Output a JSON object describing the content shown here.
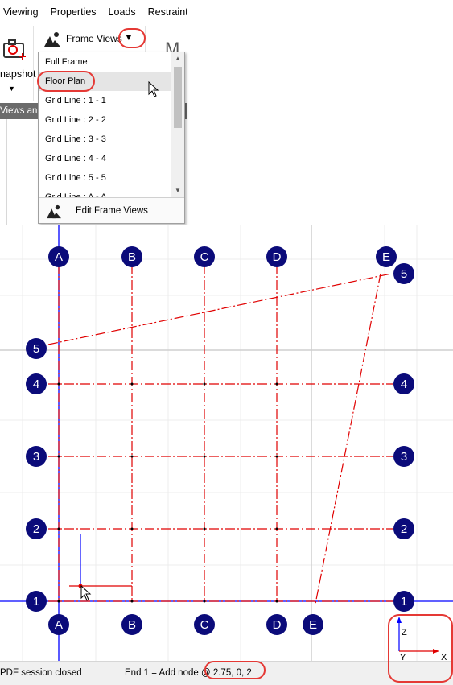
{
  "menu": [
    "Viewing",
    "Properties",
    "Loads",
    "Restraint"
  ],
  "ribbon": {
    "snapshot_label": "napshot",
    "snapshot_caret": "▼",
    "frame_views_label": "Frame Views",
    "frame_views_caret": "▼",
    "m_label": "M",
    "views_strip": "Views and"
  },
  "dropdown": {
    "items": [
      "Full Frame",
      "Floor Plan",
      "Grid Line : 1 - 1",
      "Grid Line : 2 - 2",
      "Grid Line : 3 - 3",
      "Grid Line : 4 - 4",
      "Grid Line : 5 - 5",
      "Grid Line : A - A"
    ],
    "hovered": "Floor Plan",
    "edit_label": "Edit Frame Views"
  },
  "grid": {
    "columns": [
      {
        "top": "A",
        "bottom": "A"
      },
      {
        "top": "B",
        "bottom": "B"
      },
      {
        "top": "C",
        "bottom": "C"
      },
      {
        "top": "D",
        "bottom": "D"
      },
      {
        "top": "E",
        "bottom": "E"
      }
    ],
    "rows": [
      {
        "left": "5",
        "right": "5"
      },
      {
        "left": "4",
        "right": "4"
      },
      {
        "left": "3",
        "right": "3"
      },
      {
        "left": "2",
        "right": "2"
      },
      {
        "left": "1",
        "right": "1"
      }
    ]
  },
  "axes": {
    "z": "Z",
    "y": "Y",
    "x": "X"
  },
  "status": {
    "left": "PDF session closed",
    "right": "End 1 = Add node @ 2.75, 0, 2"
  },
  "colors": {
    "bubble": "#0b0b7a",
    "gridline": "#e00000",
    "axis": "#0000ff",
    "callout": "#e53935"
  }
}
